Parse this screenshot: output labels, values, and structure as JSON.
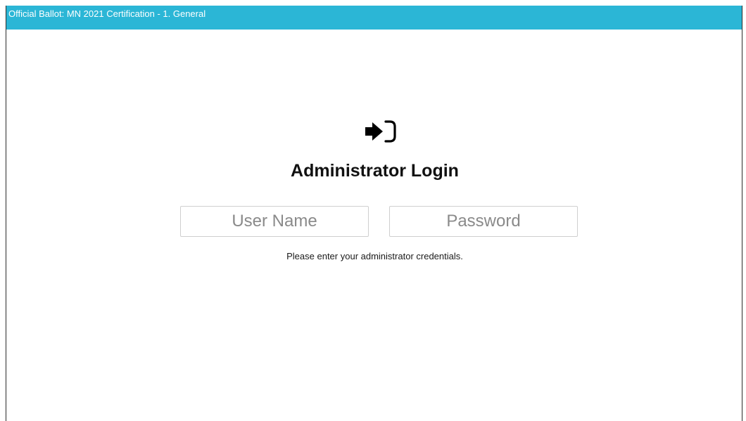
{
  "window": {
    "title": "Official Ballot: MN 2021 Certification - 1. General",
    "title_bar_color": "#2bb6d6"
  },
  "login": {
    "icon": "sign-in-icon",
    "title": "Administrator Login",
    "username": {
      "value": "",
      "placeholder": "User Name"
    },
    "password": {
      "value": "",
      "placeholder": "Password"
    },
    "hint": "Please enter your administrator credentials."
  }
}
